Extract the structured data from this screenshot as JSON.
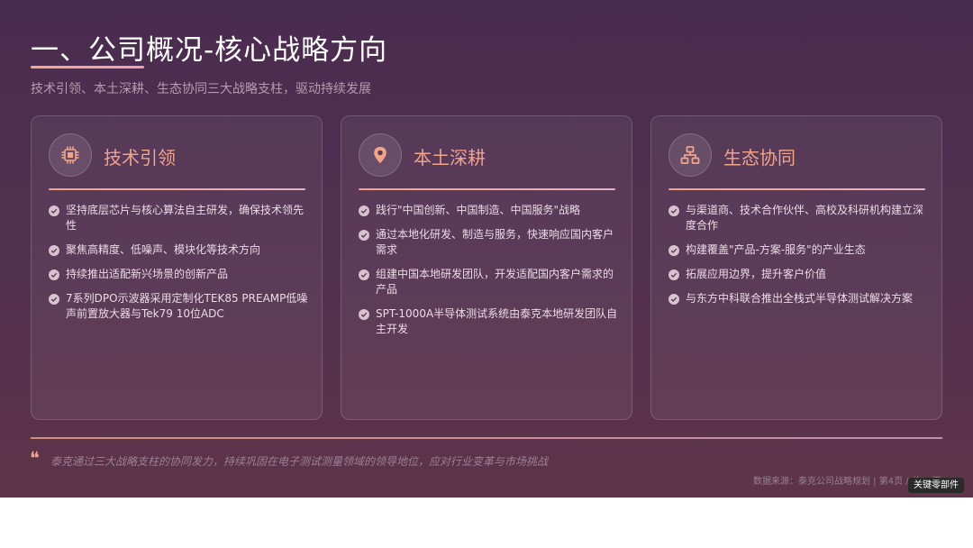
{
  "slide": {
    "title": "一、公司概况-核心战略方向",
    "subtitle": "技术引领、本土深耕、生态协同三大战略支柱，驱动持续发展"
  },
  "cards": [
    {
      "icon": "chip-icon",
      "title": "技术引领",
      "bullets": [
        "坚持底层芯片与核心算法自主研发，确保技术领先性",
        "聚焦高精度、低噪声、模块化等技术方向",
        "持续推出适配新兴场景的创新产品",
        "7系列DPO示波器采用定制化TEK85 PREAMP低噪声前置放大器与Tek79 10位ADC"
      ]
    },
    {
      "icon": "location-pin-icon",
      "title": "本土深耕",
      "bullets": [
        "践行\"中国创新、中国制造、中国服务\"战略",
        "通过本地化研发、制造与服务，快速响应国内客户需求",
        "组建中国本地研发团队，开发适配国内客户需求的产品",
        "SPT-1000A半导体测试系统由泰克本地研发团队自主开发"
      ]
    },
    {
      "icon": "network-icon",
      "title": "生态协同",
      "bullets": [
        "与渠道商、技术合作伙伴、高校及科研机构建立深度合作",
        "构建覆盖\"产品-方案-服务\"的产业生态",
        "拓展应用边界，提升客户价值",
        "与东方中科联合推出全栈式半导体测试解决方案"
      ]
    }
  ],
  "footer": {
    "quote": "泰克通过三大战略支柱的协同发力，持续巩固在电子测试测量领域的领导地位，应对行业变革与市场挑战",
    "source": "数据来源：泰克公司战略规划 | 第4页 / 共35页",
    "badge": "关键零部件"
  },
  "colors": {
    "accent": "#f0a48a",
    "background": "#4a2c50",
    "text": "#ecdbe5"
  }
}
